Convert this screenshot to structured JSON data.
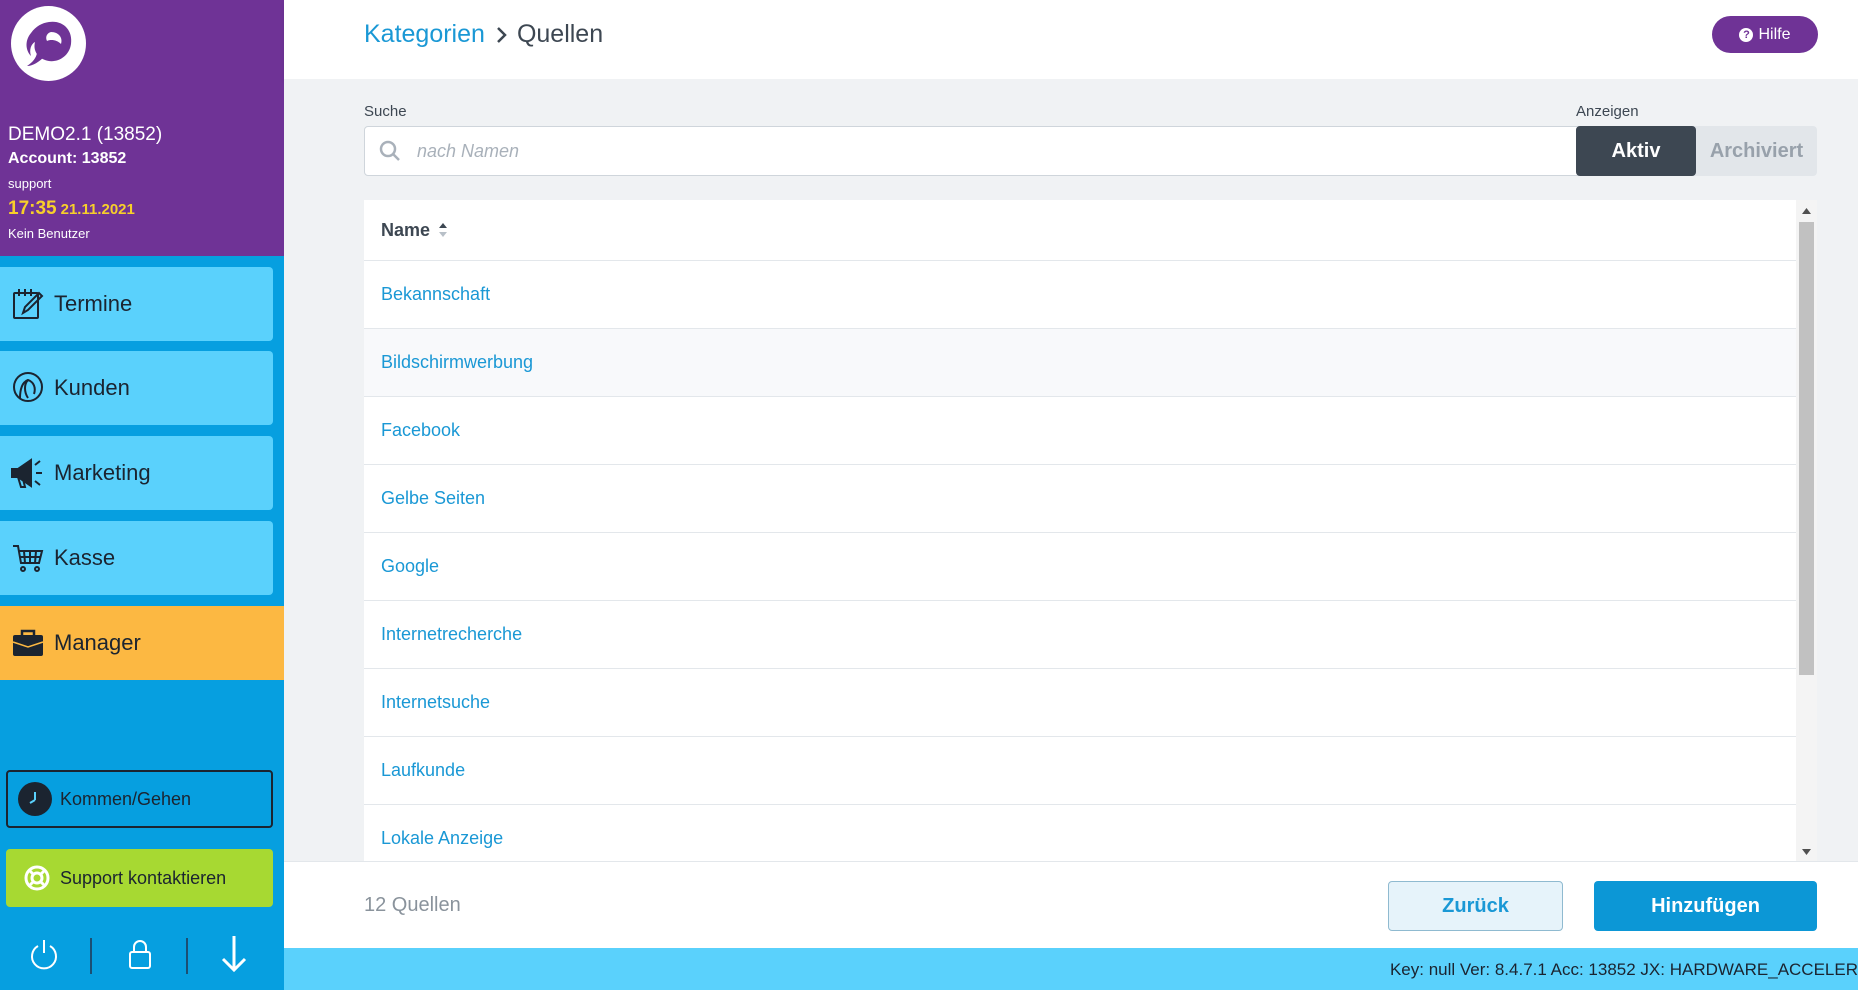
{
  "sidebar": {
    "account": {
      "name": "DEMO2.1 (13852)",
      "account": "Account: 13852",
      "user": "support",
      "time": "17:35",
      "date": "21.11.2021",
      "no_user": "Kein Benutzer"
    },
    "items": [
      {
        "label": "Termine",
        "icon": "calendar-edit-icon"
      },
      {
        "label": "Kunden",
        "icon": "customer-head-icon"
      },
      {
        "label": "Marketing",
        "icon": "megaphone-icon"
      },
      {
        "label": "Kasse",
        "icon": "cart-icon"
      },
      {
        "label": "Manager",
        "icon": "briefcase-icon"
      }
    ],
    "clock_label": "Kommen/Gehen",
    "support_label": "Support kontaktieren",
    "bottom_icons": [
      "power-icon",
      "lock-icon",
      "arrow-down-icon"
    ]
  },
  "header": {
    "breadcrumb_parent": "Kategorien",
    "breadcrumb_current": "Quellen",
    "help_label": "Hilfe"
  },
  "filters": {
    "search_label": "Suche",
    "search_placeholder": "nach Namen",
    "search_value": "",
    "show_label": "Anzeigen",
    "active_label": "Aktiv",
    "archived_label": "Archiviert",
    "selected": "Aktiv"
  },
  "table": {
    "column_name": "Name",
    "rows": [
      "Bekannschaft",
      "Bildschirmwerbung",
      "Facebook",
      "Gelbe Seiten",
      "Google",
      "Internetrecherche",
      "Internetsuche",
      "Laufkunde",
      "Lokale Anzeige"
    ]
  },
  "footer": {
    "count": "12 Quellen",
    "back_label": "Zurück",
    "add_label": "Hinzufügen"
  },
  "status": {
    "text": "Key: null Ver: 8.4.7.1 Acc: 13852  JX: HARDWARE_ACCELER"
  },
  "colors": {
    "sidebar_purple": "#6f3396",
    "sidebar_blue": "#069fe0",
    "nav_item": "#5ad1fc",
    "nav_active": "#fcb842",
    "accent": "#1a98d5",
    "time_yellow": "#f7cf2a",
    "support_green": "#a7d932",
    "toggle_active": "#3d4752"
  }
}
